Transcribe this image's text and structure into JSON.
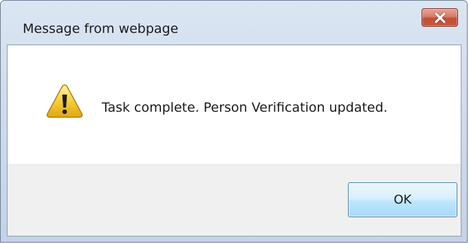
{
  "dialog": {
    "title": "Message from webpage",
    "close_icon": "close-x-icon",
    "message_icon": "warning-icon",
    "message": "Task complete. Person Verification updated.",
    "ok_label": "OK"
  },
  "colors": {
    "title_bar": "#cfdcec",
    "close_button": "#c8563c",
    "content_background": "#ffffff",
    "button_area": "#f0f0f0",
    "ok_button_border": "#3c7fb1",
    "warning_yellow": "#f5cf3a"
  }
}
